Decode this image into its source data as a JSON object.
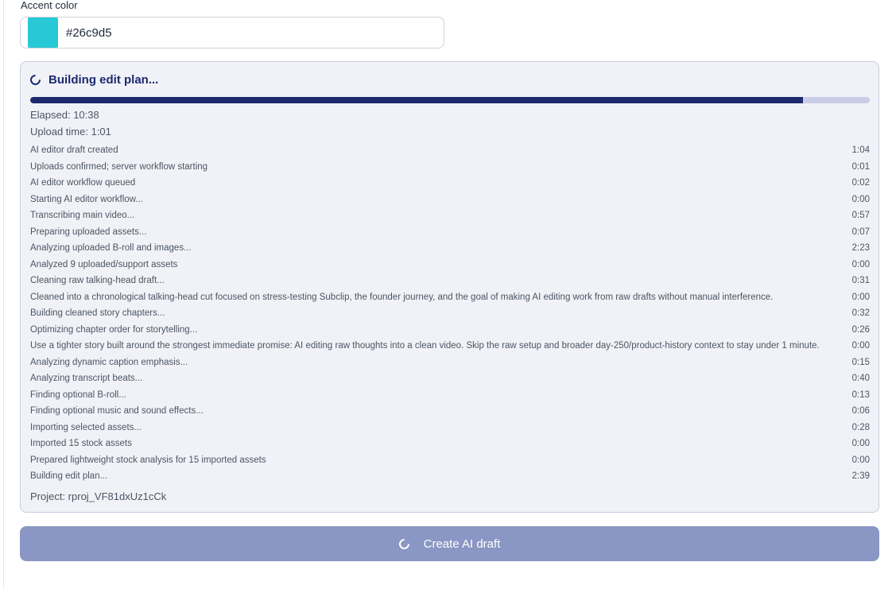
{
  "accent": {
    "label": "Accent color",
    "value": "#26c9d5",
    "swatch_color": "#26c9d5"
  },
  "status": {
    "title": "Building edit plan...",
    "progress_fraction": 0.92,
    "elapsed": "Elapsed: 10:38",
    "upload_time": "Upload time: 1:01",
    "project": "Project: rproj_VF81dxUz1cCk"
  },
  "steps": [
    {
      "label": "AI editor draft created",
      "time": "1:04"
    },
    {
      "label": "Uploads confirmed; server workflow starting",
      "time": "0:01"
    },
    {
      "label": "AI editor workflow queued",
      "time": "0:02"
    },
    {
      "label": "Starting AI editor workflow...",
      "time": "0:00"
    },
    {
      "label": "Transcribing main video...",
      "time": "0:57"
    },
    {
      "label": "Preparing uploaded assets...",
      "time": "0:07"
    },
    {
      "label": "Analyzing uploaded B-roll and images...",
      "time": "2:23"
    },
    {
      "label": "Analyzed 9 uploaded/support assets",
      "time": "0:00"
    },
    {
      "label": "Cleaning raw talking-head draft...",
      "time": "0:31"
    },
    {
      "label": "Cleaned into a chronological talking-head cut focused on stress-testing Subclip, the founder journey, and the goal of making AI editing work from raw drafts without manual interference.",
      "time": "0:00"
    },
    {
      "label": "Building cleaned story chapters...",
      "time": "0:32"
    },
    {
      "label": "Optimizing chapter order for storytelling...",
      "time": "0:26"
    },
    {
      "label": "Use a tighter story built around the strongest immediate promise: AI editing raw thoughts into a clean video. Skip the raw setup and broader day-250/product-history context to stay under 1 minute.",
      "time": "0:00"
    },
    {
      "label": "Analyzing dynamic caption emphasis...",
      "time": "0:15"
    },
    {
      "label": "Analyzing transcript beats...",
      "time": "0:40"
    },
    {
      "label": "Finding optional B-roll...",
      "time": "0:13"
    },
    {
      "label": "Finding optional music and sound effects...",
      "time": "0:06"
    },
    {
      "label": "Importing selected assets...",
      "time": "0:28"
    },
    {
      "label": "Imported 15 stock assets",
      "time": "0:00"
    },
    {
      "label": "Prepared lightweight stock analysis for 15 imported assets",
      "time": "0:00"
    },
    {
      "label": "Building edit plan...",
      "time": "2:39"
    }
  ],
  "create_button": {
    "label": "Create AI draft"
  }
}
